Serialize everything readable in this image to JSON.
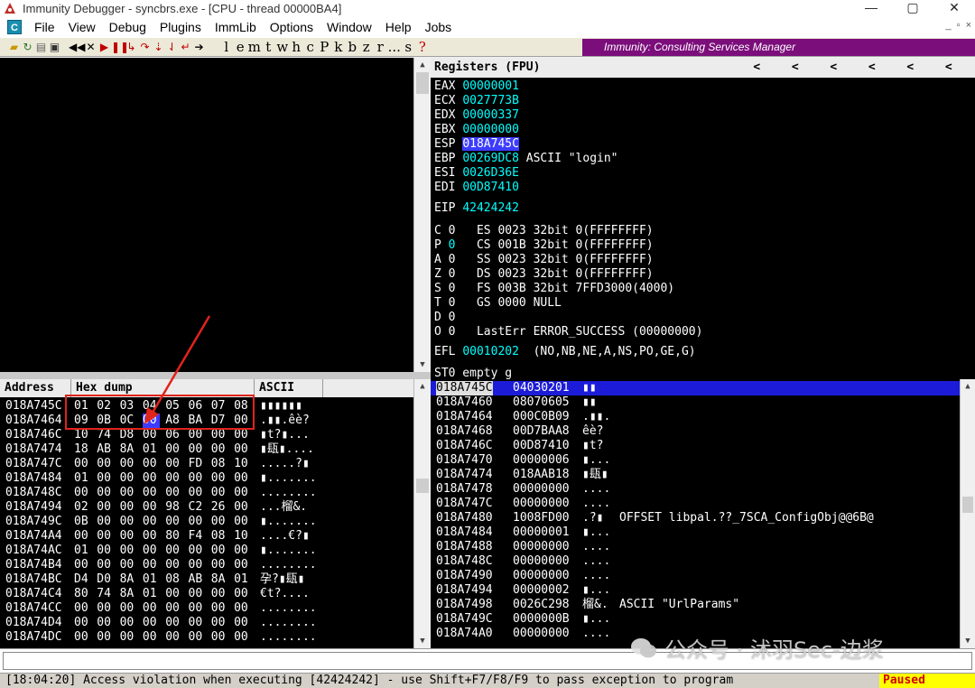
{
  "window": {
    "title": "Immunity Debugger - syncbrs.exe - [CPU - thread 00000BA4]",
    "min": "—",
    "max": "▢",
    "close": "✕"
  },
  "menu": [
    "File",
    "View",
    "Debug",
    "Plugins",
    "ImmLib",
    "Options",
    "Window",
    "Help",
    "Jobs"
  ],
  "mdi_controls": [
    "_",
    "▫",
    "×"
  ],
  "toolbar": {
    "letters": [
      "l",
      "e",
      "m",
      "t",
      "w",
      "h",
      "c",
      "P",
      "k",
      "b",
      "z",
      "r",
      "...",
      "s",
      "?"
    ],
    "banner": "Immunity: Consulting Services Manager"
  },
  "registers": {
    "title": "Registers (FPU)",
    "arrows": [
      "<",
      "<",
      "<",
      "<",
      "<",
      "<"
    ],
    "gp": [
      {
        "name": "EAX",
        "value": "00000001",
        "comment": ""
      },
      {
        "name": "ECX",
        "value": "0027773B",
        "comment": ""
      },
      {
        "name": "EDX",
        "value": "00000337",
        "comment": ""
      },
      {
        "name": "EBX",
        "value": "00000000",
        "comment": ""
      },
      {
        "name": "ESP",
        "value": "018A745C",
        "comment": ""
      },
      {
        "name": "EBP",
        "value": "00269DC8",
        "comment": "ASCII \"login\""
      },
      {
        "name": "ESI",
        "value": "0026D36E",
        "comment": ""
      },
      {
        "name": "EDI",
        "value": "00D87410",
        "comment": ""
      }
    ],
    "eip": {
      "name": "EIP",
      "value": "42424242"
    },
    "flags": [
      {
        "flag": "C",
        "val": "0",
        "seg": "ES 0023 32bit 0(FFFFFFFF)"
      },
      {
        "flag": "P",
        "val": "0",
        "seg": "CS 001B 32bit 0(FFFFFFFF)"
      },
      {
        "flag": "A",
        "val": "0",
        "seg": "SS 0023 32bit 0(FFFFFFFF)"
      },
      {
        "flag": "Z",
        "val": "0",
        "seg": "DS 0023 32bit 0(FFFFFFFF)"
      },
      {
        "flag": "S",
        "val": "0",
        "seg": "FS 003B 32bit 7FFD3000(4000)"
      },
      {
        "flag": "T",
        "val": "0",
        "seg": "GS 0000 NULL"
      },
      {
        "flag": "D",
        "val": "0",
        "seg": ""
      },
      {
        "flag": "O",
        "val": "0",
        "seg": "LastErr ERROR_SUCCESS (00000000)"
      }
    ],
    "efl": {
      "name": "EFL",
      "value": "00010202",
      "desc": "(NO,NB,NE,A,NS,PO,GE,G)"
    },
    "st0": "ST0 empty g"
  },
  "dump": {
    "headers": {
      "address": "Address",
      "hex": "Hex dump",
      "ascii": "ASCII"
    },
    "rows": [
      {
        "addr": "018A745C",
        "bytes": [
          "01",
          "02",
          "03",
          "04",
          "05",
          "06",
          "07",
          "08"
        ],
        "ascii": "▮▮▮▮▮▮"
      },
      {
        "addr": "018A7464",
        "bytes": [
          "09",
          "0B",
          "0C",
          "00",
          "A8",
          "BA",
          "D7",
          "00"
        ],
        "ascii": ".▮▮.êè?"
      },
      {
        "addr": "018A746C",
        "bytes": [
          "10",
          "74",
          "D8",
          "00",
          "06",
          "00",
          "00",
          "00"
        ],
        "ascii": "▮t?▮..."
      },
      {
        "addr": "018A7474",
        "bytes": [
          "18",
          "AB",
          "8A",
          "01",
          "00",
          "00",
          "00",
          "00"
        ],
        "ascii": "▮瓺▮...."
      },
      {
        "addr": "018A747C",
        "bytes": [
          "00",
          "00",
          "00",
          "00",
          "00",
          "FD",
          "08",
          "10"
        ],
        "ascii": ".....?▮"
      },
      {
        "addr": "018A7484",
        "bytes": [
          "01",
          "00",
          "00",
          "00",
          "00",
          "00",
          "00",
          "00"
        ],
        "ascii": "▮......."
      },
      {
        "addr": "018A748C",
        "bytes": [
          "00",
          "00",
          "00",
          "00",
          "00",
          "00",
          "00",
          "00"
        ],
        "ascii": "........"
      },
      {
        "addr": "018A7494",
        "bytes": [
          "02",
          "00",
          "00",
          "00",
          "98",
          "C2",
          "26",
          "00"
        ],
        "ascii": "...榴&."
      },
      {
        "addr": "018A749C",
        "bytes": [
          "0B",
          "00",
          "00",
          "00",
          "00",
          "00",
          "00",
          "00"
        ],
        "ascii": "▮......."
      },
      {
        "addr": "018A74A4",
        "bytes": [
          "00",
          "00",
          "00",
          "00",
          "80",
          "F4",
          "08",
          "10"
        ],
        "ascii": "....€?▮"
      },
      {
        "addr": "018A74AC",
        "bytes": [
          "01",
          "00",
          "00",
          "00",
          "00",
          "00",
          "00",
          "00"
        ],
        "ascii": "▮......."
      },
      {
        "addr": "018A74B4",
        "bytes": [
          "00",
          "00",
          "00",
          "00",
          "00",
          "00",
          "00",
          "00"
        ],
        "ascii": "........"
      },
      {
        "addr": "018A74BC",
        "bytes": [
          "D4",
          "D0",
          "8A",
          "01",
          "08",
          "AB",
          "8A",
          "01"
        ],
        "ascii": "孕?▮瓺▮"
      },
      {
        "addr": "018A74C4",
        "bytes": [
          "80",
          "74",
          "8A",
          "01",
          "00",
          "00",
          "00",
          "00"
        ],
        "ascii": "€t?...."
      },
      {
        "addr": "018A74CC",
        "bytes": [
          "00",
          "00",
          "00",
          "00",
          "00",
          "00",
          "00",
          "00"
        ],
        "ascii": "........"
      },
      {
        "addr": "018A74D4",
        "bytes": [
          "00",
          "00",
          "00",
          "00",
          "00",
          "00",
          "00",
          "00"
        ],
        "ascii": "........"
      },
      {
        "addr": "018A74DC",
        "bytes": [
          "00",
          "00",
          "00",
          "00",
          "00",
          "00",
          "00",
          "00"
        ],
        "ascii": "........"
      }
    ]
  },
  "stack": {
    "rows": [
      {
        "addr": "018A745C",
        "value": "04030201",
        "ascii": "▮▮",
        "comment": ""
      },
      {
        "addr": "018A7460",
        "value": "08070605",
        "ascii": "▮▮",
        "comment": ""
      },
      {
        "addr": "018A7464",
        "value": "000C0B09",
        "ascii": ".▮▮.",
        "comment": ""
      },
      {
        "addr": "018A7468",
        "value": "00D7BAA8",
        "ascii": "êè?",
        "comment": ""
      },
      {
        "addr": "018A746C",
        "value": "00D87410",
        "ascii": "▮t?",
        "comment": ""
      },
      {
        "addr": "018A7470",
        "value": "00000006",
        "ascii": "▮...",
        "comment": ""
      },
      {
        "addr": "018A7474",
        "value": "018AAB18",
        "ascii": "▮瓺▮",
        "comment": ""
      },
      {
        "addr": "018A7478",
        "value": "00000000",
        "ascii": "....",
        "comment": ""
      },
      {
        "addr": "018A747C",
        "value": "00000000",
        "ascii": "....",
        "comment": ""
      },
      {
        "addr": "018A7480",
        "value": "1008FD00",
        "ascii": ".?▮",
        "comment": "OFFSET libpal.??_7SCA_ConfigObj@@6B@"
      },
      {
        "addr": "018A7484",
        "value": "00000001",
        "ascii": "▮...",
        "comment": ""
      },
      {
        "addr": "018A7488",
        "value": "00000000",
        "ascii": "....",
        "comment": ""
      },
      {
        "addr": "018A748C",
        "value": "00000000",
        "ascii": "....",
        "comment": ""
      },
      {
        "addr": "018A7490",
        "value": "00000000",
        "ascii": "....",
        "comment": ""
      },
      {
        "addr": "018A7494",
        "value": "00000002",
        "ascii": "▮...",
        "comment": ""
      },
      {
        "addr": "018A7498",
        "value": "0026C298",
        "ascii": "榴&.",
        "comment": "ASCII \"UrlParams\""
      },
      {
        "addr": "018A749C",
        "value": "0000000B",
        "ascii": "▮...",
        "comment": ""
      },
      {
        "addr": "018A74A0",
        "value": "00000000",
        "ascii": "....",
        "comment": ""
      }
    ]
  },
  "status": {
    "message": "[18:04:20] Access violation when executing [42424242] - use Shift+F7/F8/F9 to pass exception to program",
    "state": "Paused"
  },
  "watermark": "公众号 · 沭羽Sec-边浆",
  "colors": {
    "banner": "#7b0e7b",
    "highlight": "#3c3cff",
    "register_value": "#00ffff",
    "annotation": "#e0241b",
    "paused_bg": "#ffff00"
  }
}
